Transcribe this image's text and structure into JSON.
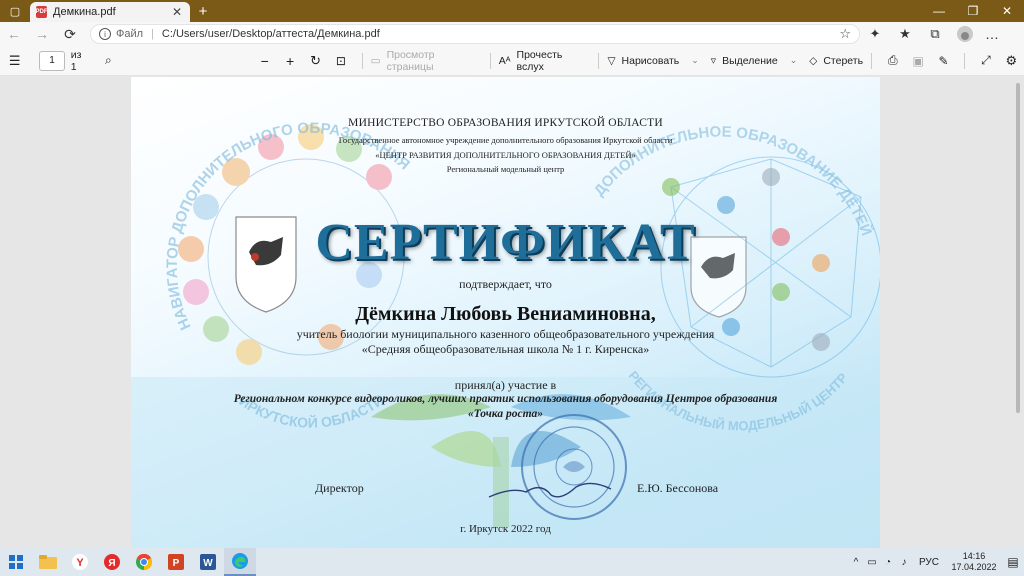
{
  "window": {
    "tab_title": "Демкина.pdf",
    "new_tab_symbol": "+",
    "tab_close_symbol": "✕",
    "controls": {
      "minimize": "—",
      "restore": "❐",
      "close": "✕"
    }
  },
  "addressbar": {
    "scheme_label": "Файл",
    "url": "C:/Users/user/Desktop/аттеста/Демкина.pdf",
    "back_icon": "←",
    "forward_icon": "→",
    "refresh_icon": "⟳"
  },
  "pdf_toolbar": {
    "page_current": "1",
    "page_of": "из 1",
    "page_view_label": "Просмотр страницы",
    "read_aloud_label": "Прочесть вслух",
    "draw_label": "Нарисовать",
    "highlight_label": "Выделение",
    "erase_label": "Стереть"
  },
  "certificate": {
    "ministry": "МИНИСТЕРСТВО ОБРАЗОВАНИЯ ИРКУТСКОЙ ОБЛАСТИ",
    "institution_line1": "Государственное автономное учреждение дополнительного образования Иркутской области",
    "institution_line2": "«ЦЕНТР РАЗВИТИЯ ДОПОЛНИТЕЛЬНОГО ОБРАЗОВАНИЯ ДЕТЕЙ»",
    "institution_line3": "Региональный модельный центр",
    "heading": "СЕРТИФИКАТ",
    "confirms": "подтверждает, что",
    "name": "Дёмкина Любовь Вениаминовна,",
    "position_line1": "учитель биологии муниципального казенного общеобразовательного учреждения",
    "position_line2": "«Средняя общеобразовательная школа № 1 г. Киренска»",
    "participated": "принял(а) участие в",
    "contest_line1": "Региональном конкурсе видеороликов, лучших практик использования оборудования Центров образования",
    "contest_line2": "«Точка роста»",
    "director_label": "Директор",
    "director_name": "Е.Ю. Бессонова",
    "city_year": "г. Иркутск 2022 год",
    "arc_left_top": "НАВИГАТОР ДОПОЛНИТЕЛЬНОГО ОБРАЗОВАНИЯ",
    "arc_left_bottom": "ИРКУТСКОЙ ОБЛАСТИ",
    "arc_right_top": "ДОПОЛНИТЕЛЬНОЕ ОБРАЗОВАНИЕ ДЕТЕЙ",
    "arc_right_bottom": "РЕГИОНАЛЬНЫЙ МОДЕЛЬНЫЙ ЦЕНТР"
  },
  "taskbar": {
    "language": "РУС",
    "time": "14:16",
    "date": "17.04.2022"
  }
}
